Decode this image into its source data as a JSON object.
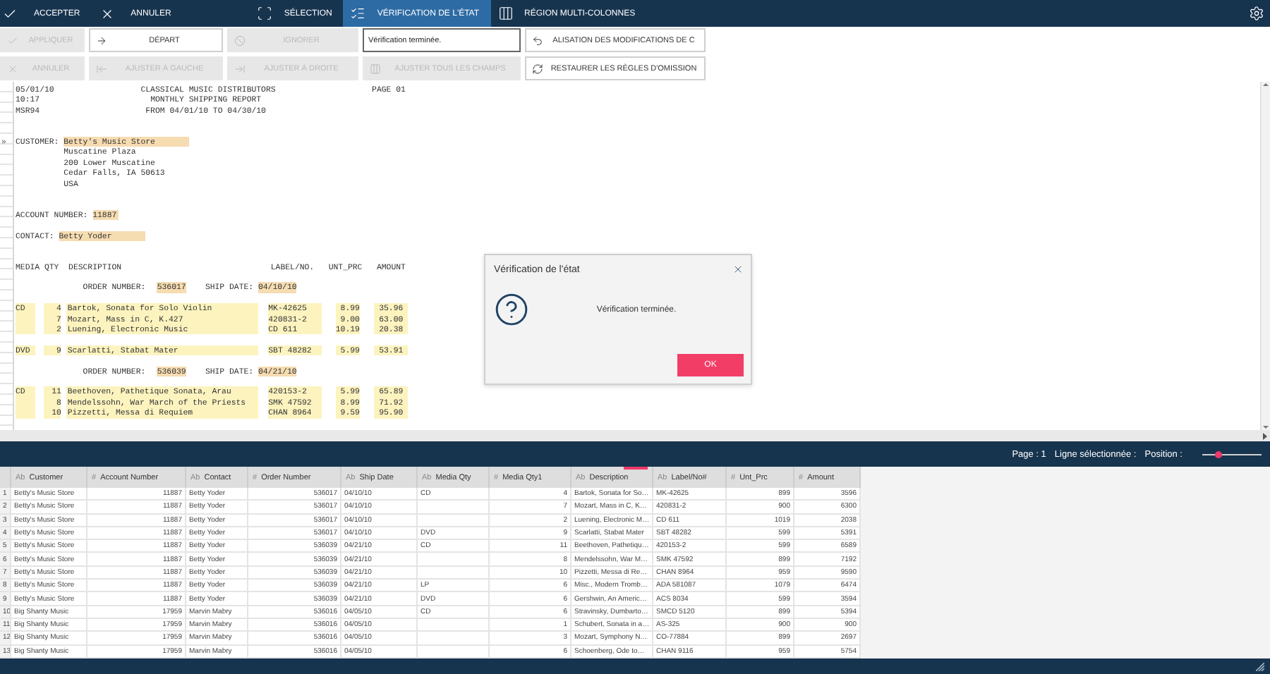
{
  "actions": [
    {
      "label": "ACCEPTER"
    },
    {
      "label": "ANNULER"
    }
  ],
  "modes": [
    {
      "label": "SÉLECTION",
      "selected": false
    },
    {
      "label": "VÉRIFICATION DE L'ÉTAT",
      "selected": true
    },
    {
      "label": "RÉGION MULTI-COLONNES",
      "selected": false
    }
  ],
  "toolbar": [
    {
      "kind": "button",
      "label": "APPLIQUER",
      "disabled": true
    },
    {
      "kind": "button",
      "label": "DÉPART",
      "disabled": false
    },
    {
      "kind": "button",
      "label": "IGNORER",
      "disabled": true
    },
    {
      "kind": "field",
      "value": "Vérification terminée."
    },
    {
      "kind": "button",
      "label": "ALISATION DES MODIFICATIONS DE C",
      "disabled": false
    },
    {
      "kind": "button",
      "label": "ANNULER",
      "disabled": true
    },
    {
      "kind": "button",
      "label": "AJUSTER À GAUCHE",
      "disabled": true
    },
    {
      "kind": "button",
      "label": "AJUSTER À DROITE",
      "disabled": true
    },
    {
      "kind": "button",
      "label": "AJUSTER TOUS LES CHAMPS",
      "disabled": true
    },
    {
      "kind": "button",
      "label": "RESTAURER LES RÈGLES D'OMISSION",
      "disabled": false
    }
  ],
  "report": {
    "header": {
      "date": "05/01/10",
      "title": "CLASSICAL MUSIC DISTRIBUTORS",
      "page": "PAGE 01",
      "time": "10:17",
      "subtitle": "MONTHLY SHIPPING REPORT",
      "code": "MSR94",
      "range": "FROM 04/01/10 TO 04/30/10"
    },
    "customer": {
      "marker": "»",
      "label": "CUSTOMER:",
      "name": "Betty's Music Store",
      "address": [
        "Muscatine Plaza",
        "200 Lower Muscatine",
        "Cedar Falls, IA 50613",
        "USA"
      ]
    },
    "account": {
      "label": "ACCOUNT NUMBER:",
      "value": "11887"
    },
    "contact": {
      "label": "CONTACT:",
      "value": "Betty Yoder"
    },
    "columns": [
      "MEDIA",
      "QTY",
      "DESCRIPTION",
      "LABEL/NO.",
      "UNT_PRC",
      "AMOUNT"
    ],
    "orders": [
      {
        "label": "ORDER NUMBER:",
        "number": "536017",
        "date_label": "SHIP DATE:",
        "date": "04/10/10",
        "groups": [
          {
            "media": "CD",
            "items": [
              {
                "qty": "4",
                "description": "Bartok, Sonata for Solo Violin",
                "label": "MK-42625",
                "price": "8.99",
                "amount": "35.96"
              },
              {
                "qty": "7",
                "description": "Mozart, Mass in C, K.427",
                "label": "420831-2",
                "price": "9.00",
                "amount": "63.00"
              },
              {
                "qty": "2",
                "description": "Luening, Electronic Music",
                "label": "CD 611",
                "price": "10.19",
                "amount": "20.38"
              }
            ]
          },
          {
            "media": "DVD",
            "items": [
              {
                "qty": "9",
                "description": "Scarlatti, Stabat Mater",
                "label": "SBT 48282",
                "price": "5.99",
                "amount": "53.91"
              }
            ]
          }
        ]
      },
      {
        "label": "ORDER NUMBER:",
        "number": "536039",
        "date_label": "SHIP DATE:",
        "date": "04/21/10",
        "groups": [
          {
            "media": "CD",
            "items": [
              {
                "qty": "11",
                "description": "Beethoven, Pathetique Sonata, Arau",
                "label": "420153-2",
                "price": "5.99",
                "amount": "65.89"
              },
              {
                "qty": "8",
                "description": "Mendelssohn, War March of the Priests",
                "label": "SMK 47592",
                "price": "8.99",
                "amount": "71.92"
              },
              {
                "qty": "10",
                "description": "Pizzetti, Messa di Requiem",
                "label": "CHAN 8964",
                "price": "9.59",
                "amount": "95.90"
              }
            ]
          }
        ]
      }
    ]
  },
  "status": {
    "page": "Page : 1",
    "selected_line": "Ligne sélectionnée :",
    "position": "Position :",
    "position_slider": {
      "level": 0.28
    }
  },
  "dialog": {
    "title": "Vérification de l'état",
    "message": "Vérification terminée.",
    "button": "OK"
  },
  "table": {
    "columns": [
      {
        "kind": "text",
        "type_mark": "Ab",
        "title": "Customer"
      },
      {
        "kind": "number",
        "type_mark": "#",
        "title": "Account Number"
      },
      {
        "kind": "text",
        "type_mark": "Ab",
        "title": "Contact"
      },
      {
        "kind": "number",
        "type_mark": "#",
        "title": "Order Number"
      },
      {
        "kind": "text",
        "type_mark": "Ab",
        "title": "Ship Date"
      },
      {
        "kind": "text",
        "type_mark": "Ab",
        "title": "Media Qty"
      },
      {
        "kind": "number",
        "type_mark": "#",
        "title": "Media Qty1"
      },
      {
        "kind": "text",
        "type_mark": "Ab",
        "title": "Description"
      },
      {
        "kind": "text",
        "type_mark": "Ab",
        "title": "Label/No#"
      },
      {
        "kind": "number",
        "type_mark": "#",
        "title": "Unt_Prc"
      },
      {
        "kind": "number",
        "type_mark": "#",
        "title": "Amount"
      }
    ],
    "rows": [
      {
        "number": "1",
        "cells": [
          "Betty's Music Store",
          "11887",
          "Betty Yoder",
          "536017",
          "04/10/10",
          "CD",
          "4",
          "Bartok, Sonata for So…",
          "MK-42625",
          "899",
          "3596"
        ]
      },
      {
        "number": "2",
        "cells": [
          "Betty's Music Store",
          "11887",
          "Betty Yoder",
          "536017",
          "04/10/10",
          null,
          "7",
          "Mozart, Mass in C, K…",
          "420831-2",
          "900",
          "6300"
        ]
      },
      {
        "number": "3",
        "cells": [
          "Betty's Music Store",
          "11887",
          "Betty Yoder",
          "536017",
          "04/10/10",
          null,
          "2",
          "Luening, Electronic M…",
          "CD 611",
          "1019",
          "2038"
        ]
      },
      {
        "number": "4",
        "cells": [
          "Betty's Music Store",
          "11887",
          "Betty Yoder",
          "536017",
          "04/10/10",
          "DVD",
          "9",
          "Scarlatti, Stabat Mater",
          "SBT 48282",
          "599",
          "5391"
        ]
      },
      {
        "number": "5",
        "cells": [
          "Betty's Music Store",
          "11887",
          "Betty Yoder",
          "536039",
          "04/21/10",
          "CD",
          "11",
          "Beethoven, Pathetiqu…",
          "420153-2",
          "599",
          "6589"
        ]
      },
      {
        "number": "6",
        "cells": [
          "Betty's Music Store",
          "11887",
          "Betty Yoder",
          "536039",
          "04/21/10",
          null,
          "8",
          "Mendelssohn, War M…",
          "SMK 47592",
          "899",
          "7192"
        ]
      },
      {
        "number": "7",
        "cells": [
          "Betty's Music Store",
          "11887",
          "Betty Yoder",
          "536039",
          "04/21/10",
          null,
          "10",
          "Pizzetti, Messa di Re…",
          "CHAN 8964",
          "959",
          "9590"
        ]
      },
      {
        "number": "8",
        "cells": [
          "Betty's Music Store",
          "11887",
          "Betty Yoder",
          "536039",
          "04/21/10",
          "LP",
          "6",
          "Misc., Modern Tromb…",
          "ADA 581087",
          "1079",
          "6474"
        ]
      },
      {
        "number": "9",
        "cells": [
          "Betty's Music Store",
          "11887",
          "Betty Yoder",
          "536039",
          "04/21/10",
          "DVD",
          "6",
          "Gershwin, An Americ…",
          "ACS 8034",
          "599",
          "3594"
        ]
      },
      {
        "number": "10",
        "cells": [
          "Big Shanty Music",
          "17959",
          "Marvin Mabry",
          "536016",
          "04/05/10",
          "CD",
          "6",
          "Stravinsky, Dumbarto…",
          "SMCD 5120",
          "899",
          "5394"
        ]
      },
      {
        "number": "11",
        "cells": [
          "Big Shanty Music",
          "17959",
          "Marvin Mabry",
          "536016",
          "04/05/10",
          null,
          "1",
          "Schubert, Sonata in a…",
          "AS-325",
          "900",
          "900"
        ]
      },
      {
        "number": "12",
        "cells": [
          "Big Shanty Music",
          "17959",
          "Marvin Mabry",
          "536016",
          "04/05/10",
          null,
          "3",
          "Mozart, Symphony N…",
          "CO-77884",
          "899",
          "2697"
        ]
      },
      {
        "number": "13",
        "cells": [
          "Big Shanty Music",
          "17959",
          "Marvin Mabry",
          "536016",
          "04/05/10",
          null,
          "6",
          "Schoenberg, Ode to…",
          "CHAN 9116",
          "959",
          "5754"
        ]
      }
    ]
  }
}
